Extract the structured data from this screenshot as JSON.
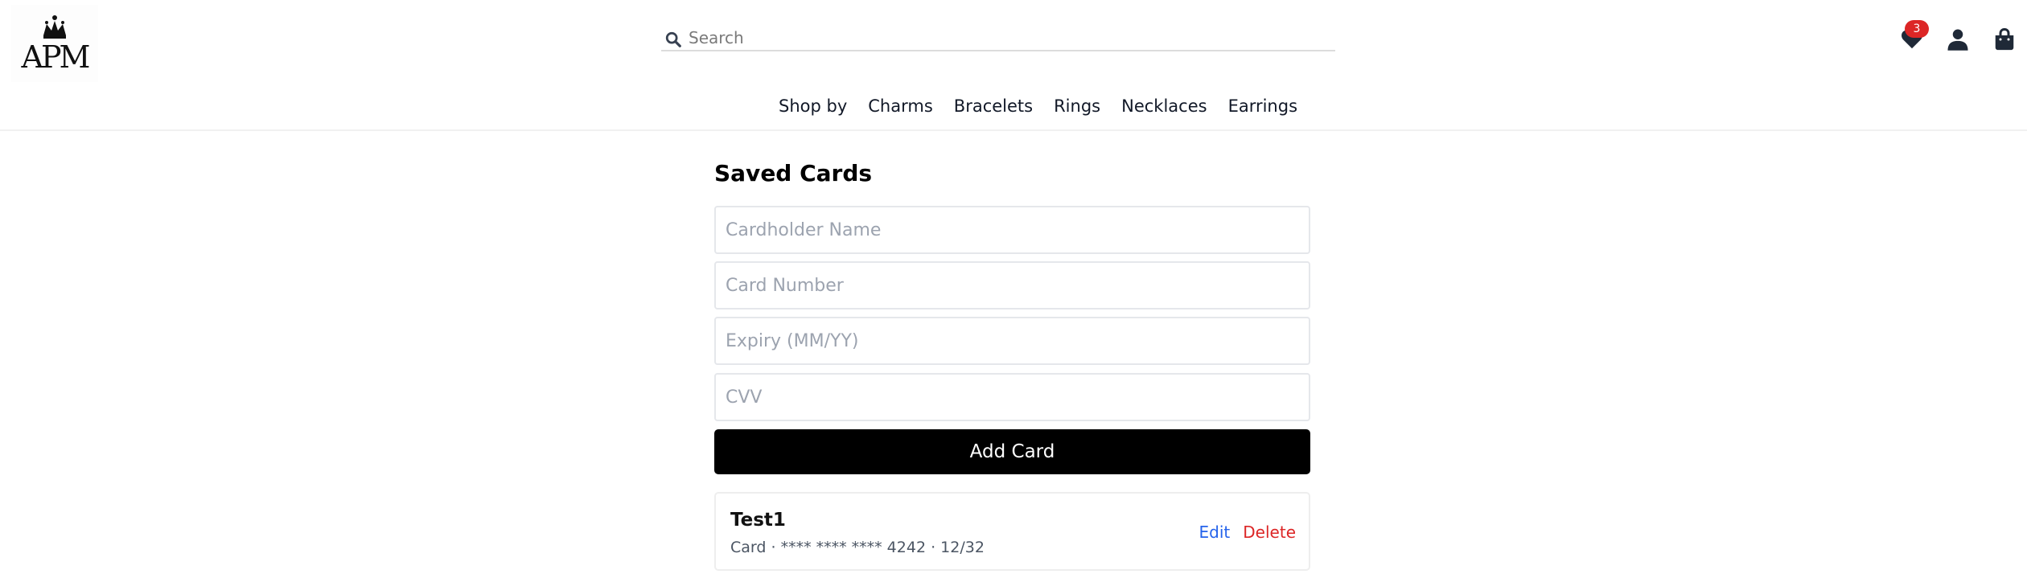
{
  "header": {
    "logo_text": "APM",
    "search": {
      "placeholder": "Search",
      "value": ""
    },
    "wishlist_count": "3",
    "icons": [
      "search-icon",
      "heart-icon",
      "user-icon",
      "shopping-bag-icon",
      "crown-icon"
    ]
  },
  "nav": {
    "items": [
      {
        "label": "Shop by"
      },
      {
        "label": "Charms"
      },
      {
        "label": "Bracelets"
      },
      {
        "label": "Rings"
      },
      {
        "label": "Necklaces"
      },
      {
        "label": "Earrings"
      }
    ]
  },
  "main": {
    "title": "Saved Cards",
    "form": {
      "cardholder_placeholder": "Cardholder Name",
      "card_number_placeholder": "Card Number",
      "expiry_placeholder": "Expiry (MM/YY)",
      "cvv_placeholder": "CVV",
      "submit_label": "Add Card"
    },
    "saved_cards": [
      {
        "name": "Test1",
        "details": "Card · **** **** **** 4242 · 12/32",
        "edit_label": "Edit",
        "delete_label": "Delete"
      }
    ]
  },
  "colors": {
    "badge": "#dc2626",
    "edit": "#2563eb",
    "delete": "#dc2626",
    "primary_button": "#000000"
  }
}
